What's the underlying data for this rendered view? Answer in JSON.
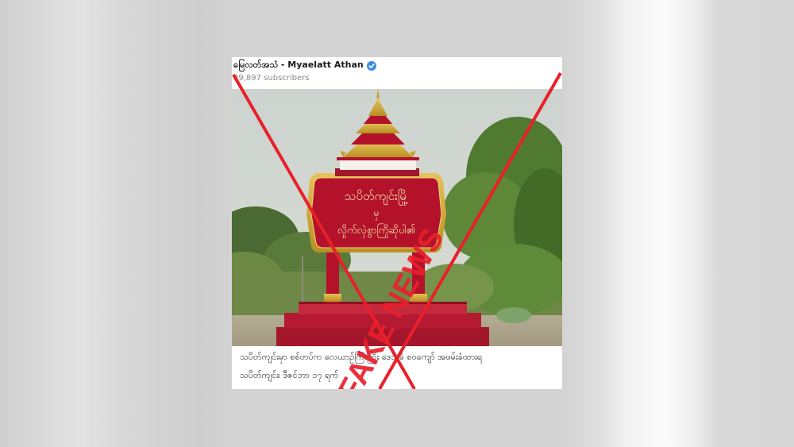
{
  "post": {
    "channel_name": "မြေလတ်အသံ - Myaelatt Athan",
    "subscribers": "39,897 subscribers",
    "verified_icon": "verified-check-icon",
    "sign_text_line1": "သပိတ်ကျင်းမြို့",
    "sign_text_line2": "မှ",
    "sign_text_line3": "လှိုက်လှဲစွာကြိုဆိုပါ၏",
    "caption_line1": "သပိတ်ကျင်းမှာ စစ်တပ်က လေယာဉ်ကြီးကြိုး ဒေသခံ စဝကျော် အဖမ်းခံထားရ",
    "caption_line2": "သပိတ်ကျင်း၊ ဒီဇင်ဘာ ၁၇ ရက်"
  },
  "stamp": {
    "text": "FAKE NEWS",
    "color": "#e8202a"
  },
  "colors": {
    "sign_red": "#b3122a",
    "sign_gold": "#c9a227",
    "verified_blue": "#3d8be6"
  }
}
